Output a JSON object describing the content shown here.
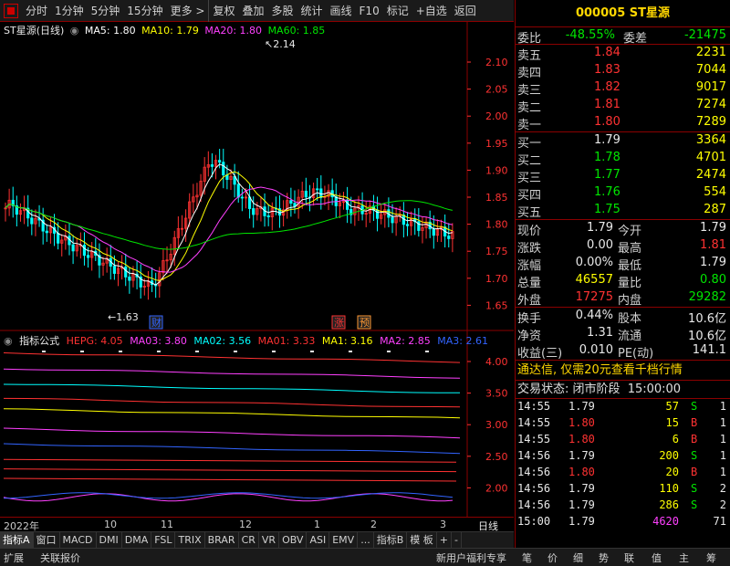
{
  "toolbar": {
    "items": [
      "分时",
      "1分钟",
      "5分钟",
      "15分钟",
      "更多 >",
      "复权",
      "叠加",
      "多股",
      "统计",
      "画线",
      "F10",
      "标记",
      "+自选",
      "返回"
    ]
  },
  "chart": {
    "title": "ST星源(日线)",
    "ma": [
      {
        "label": "MA5: 1.80",
        "color": "#ffffff"
      },
      {
        "label": "MA10: 1.79",
        "color": "#ffff00"
      },
      {
        "label": "MA20: 1.80",
        "color": "#ff40ff"
      },
      {
        "label": "MA60: 1.85",
        "color": "#00e600"
      }
    ],
    "price_axis": [
      "2.10",
      "2.05",
      "2.00",
      "1.95",
      "1.90",
      "1.85",
      "1.80",
      "1.75",
      "1.70",
      "1.65"
    ],
    "high_label": "2.14",
    "low_label": "1.63",
    "markers": [
      "财",
      "涨",
      "预"
    ],
    "indicator": {
      "name": "指标公式",
      "items": [
        {
          "label": "HEPG: 4.05",
          "color": "#ff3232"
        },
        {
          "label": "MA03: 3.80",
          "color": "#ff40ff"
        },
        {
          "label": "MA02: 3.56",
          "color": "#00ffff"
        },
        {
          "label": "MA01: 3.33",
          "color": "#ff3232"
        },
        {
          "label": "MA1: 3.16",
          "color": "#ffff00"
        },
        {
          "label": "MA2: 2.85",
          "color": "#ff40ff"
        },
        {
          "label": "MA3: 2.61",
          "color": "#3264ff"
        }
      ],
      "axis": [
        "4.00",
        "3.50",
        "3.00",
        "2.50",
        "2.00"
      ]
    },
    "dates": [
      "2022年",
      "10",
      "11",
      "12",
      "1",
      "2",
      "3",
      "日线"
    ]
  },
  "tabs": [
    "指标A",
    "窗口",
    "MACD",
    "DMI",
    "DMA",
    "FSL",
    "TRIX",
    "BRAR",
    "CR",
    "VR",
    "OBV",
    "ASI",
    "EMV",
    "...",
    "指标B",
    "模 板",
    "+",
    "-"
  ],
  "bottom": {
    "left": [
      "扩展",
      "关联报价"
    ],
    "promo": "新用户福利专享",
    "right_tabs": [
      "笔",
      "价",
      "细",
      "势",
      "联",
      "值",
      "主",
      "筹"
    ]
  },
  "quote": {
    "code": "000005",
    "name": "ST星源",
    "weibi_label": "委比",
    "weibi": "-48.55%",
    "weicha_label": "委差",
    "weicha": "-21475",
    "asks": [
      {
        "label": "卖五",
        "price": "1.84",
        "vol": "2231"
      },
      {
        "label": "卖四",
        "price": "1.83",
        "vol": "7044"
      },
      {
        "label": "卖三",
        "price": "1.82",
        "vol": "9017"
      },
      {
        "label": "卖二",
        "price": "1.81",
        "vol": "7274"
      },
      {
        "label": "卖一",
        "price": "1.80",
        "vol": "7289"
      }
    ],
    "bids": [
      {
        "label": "买一",
        "price": "1.79",
        "vol": "3364"
      },
      {
        "label": "买二",
        "price": "1.78",
        "vol": "4701"
      },
      {
        "label": "买三",
        "price": "1.77",
        "vol": "2474"
      },
      {
        "label": "买四",
        "price": "1.76",
        "vol": "554"
      },
      {
        "label": "买五",
        "price": "1.75",
        "vol": "287"
      }
    ],
    "stats": [
      {
        "l1": "现价",
        "v1": "1.79",
        "l2": "今开",
        "v2": "1.79"
      },
      {
        "l1": "涨跌",
        "v1": "0.00",
        "l2": "最高",
        "v2": "1.81"
      },
      {
        "l1": "涨幅",
        "v1": "0.00%",
        "l2": "最低",
        "v2": "1.79"
      },
      {
        "l1": "总量",
        "v1": "46557",
        "l2": "量比",
        "v2": "0.80"
      },
      {
        "l1": "外盘",
        "v1": "17275",
        "l2": "内盘",
        "v2": "29282"
      }
    ],
    "fund": [
      {
        "l1": "换手",
        "v1": "0.44%",
        "l2": "股本",
        "v2": "10.6亿"
      },
      {
        "l1": "净资",
        "v1": "1.31",
        "l2": "流通",
        "v2": "10.6亿"
      },
      {
        "l1": "收益(三)",
        "v1": "0.010",
        "l2": "PE(动)",
        "v2": "141.1"
      }
    ],
    "ad": "通达信, 仅需20元查看千档行情",
    "status_label": "交易状态:",
    "status_value": "闭市阶段",
    "status_time": "15:00:00",
    "ticks": [
      {
        "time": "14:55",
        "price": "1.79",
        "vol": "57",
        "side": "S",
        "n": "1"
      },
      {
        "time": "14:55",
        "price": "1.80",
        "vol": "15",
        "side": "B",
        "n": "1"
      },
      {
        "time": "14:55",
        "price": "1.80",
        "vol": "6",
        "side": "B",
        "n": "1"
      },
      {
        "time": "14:56",
        "price": "1.79",
        "vol": "200",
        "side": "S",
        "n": "1"
      },
      {
        "time": "14:56",
        "price": "1.80",
        "vol": "20",
        "side": "B",
        "n": "1"
      },
      {
        "time": "14:56",
        "price": "1.79",
        "vol": "110",
        "side": "S",
        "n": "2"
      },
      {
        "time": "14:56",
        "price": "1.79",
        "vol": "286",
        "side": "S",
        "n": "2"
      },
      {
        "time": "15:00",
        "price": "1.79",
        "vol": "4620",
        "side": "",
        "n": "71"
      }
    ]
  },
  "colors": {
    "up": "#ff3232",
    "down": "#00ffff",
    "ma5": "#ffffff",
    "ma10": "#ffff00",
    "ma20": "#ff40ff",
    "ma60": "#00e600",
    "frame": "#8b0000"
  }
}
